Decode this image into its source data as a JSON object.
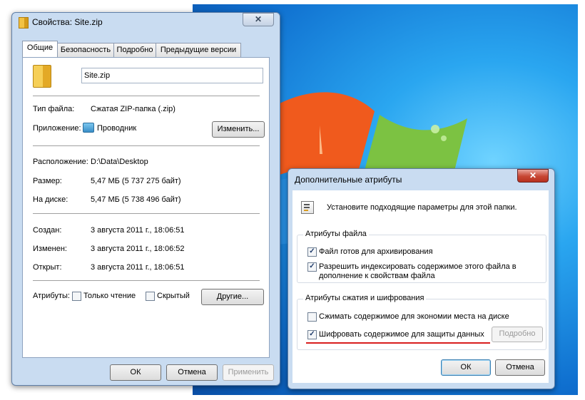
{
  "properties": {
    "title": "Свойства: Site.zip",
    "close_glyph": "✕",
    "tabs": [
      "Общие",
      "Безопасность",
      "Подробно",
      "Предыдущие версии"
    ],
    "filename": "Site.zip",
    "type_label": "Тип файла:",
    "type_value": "Сжатая ZIP-папка (.zip)",
    "app_label": "Приложение:",
    "app_value": "Проводник",
    "change_button": "Изменить...",
    "location_label": "Расположение:",
    "location_value": "D:\\Data\\Desktop",
    "size_label": "Размер:",
    "size_value": "5,47 МБ (5 737 275 байт)",
    "disk_label": "На диске:",
    "disk_value": "5,47 МБ (5 738 496 байт)",
    "created_label": "Создан:",
    "created_value": "3 августа 2011 г., 18:06:51",
    "modified_label": "Изменен:",
    "modified_value": "3 августа 2011 г., 18:06:52",
    "opened_label": "Открыт:",
    "opened_value": "3 августа 2011 г., 18:06:51",
    "attributes_label": "Атрибуты:",
    "readonly_label": "Только чтение",
    "hidden_label": "Скрытый",
    "other_button": "Другие...",
    "ok_button": "ОК",
    "cancel_button": "Отмена",
    "apply_button": "Применить"
  },
  "advanced": {
    "title": "Дополнительные атрибуты",
    "close_glyph": "✕",
    "description": "Установите подходящие параметры для этой папки.",
    "file_group_title": "Атрибуты файла",
    "archive_label": "Файл готов для архивирования",
    "index_label_line1": "Разрешить индексировать содержимое этого файла в",
    "index_label_line2": "дополнение к свойствам файла",
    "compress_group_title": "Атрибуты сжатия и шифрования",
    "compress_label": "Сжимать содержимое для экономии места на диске",
    "encrypt_label": "Шифровать содержимое для защиты данных",
    "details_button": "Подробно",
    "ok_button": "ОК",
    "cancel_button": "Отмена",
    "checked": {
      "archive": true,
      "index": true,
      "compress": false,
      "encrypt": true
    },
    "highlight_color": "#d81e1e"
  },
  "colors": {
    "title_bar": "#c9dcf1",
    "desktop_blue": "#1f86e0"
  }
}
